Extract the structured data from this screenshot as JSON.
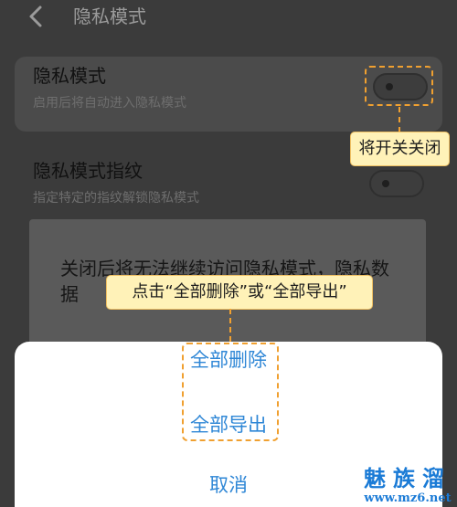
{
  "header": {
    "back_icon": "chevron-left-icon",
    "title": "隐私模式"
  },
  "settings": {
    "privacy_mode": {
      "title": "隐私模式",
      "description": "启用后将自动进入隐私模式"
    },
    "fingerprint": {
      "title": "隐私模式指纹",
      "description": "指定特定的指纹解锁隐私模式"
    }
  },
  "dialog": {
    "message": "关闭后将无法继续访问隐私模式，隐私数据"
  },
  "action_sheet": {
    "delete_all": "全部删除",
    "export_all": "全部导出",
    "cancel": "取消"
  },
  "annotations": {
    "switch_tip": "将开关关闭",
    "sheet_tip": "点击“全部删除”或“全部导出”"
  },
  "watermark": {
    "name": "魅族溜",
    "url": "www.mz6.net"
  },
  "colors": {
    "accent": "#2f87d6",
    "annotation_border": "#f0a030",
    "callout_bg": "#fff2b8"
  }
}
